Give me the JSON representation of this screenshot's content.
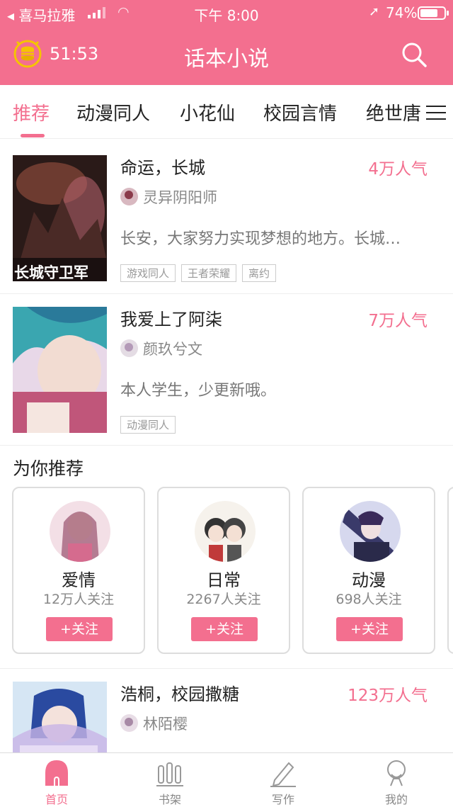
{
  "status_bar": {
    "carrier": "◂ 喜马拉雅",
    "time": "下午 8:00",
    "battery": "74%"
  },
  "header": {
    "timer": "51:53",
    "title": "话本小说"
  },
  "tabs": [
    {
      "label": "推荐",
      "active": true
    },
    {
      "label": "动漫同人",
      "active": false
    },
    {
      "label": "小花仙",
      "active": false
    },
    {
      "label": "校园言情",
      "active": false
    },
    {
      "label": "绝世唐",
      "active": false
    }
  ],
  "books": [
    {
      "title": "命运，长城",
      "popularity": "4万人气",
      "author": "灵异阴阳师",
      "description": "长安，大家努力实现梦想的地方。长城…",
      "tags": [
        "游戏同人",
        "王者荣耀",
        "离约"
      ],
      "cover_text": "长城守卫军"
    },
    {
      "title": "我爱上了阿柒",
      "popularity": "7万人气",
      "author": "颜玖兮文",
      "description": "本人学生，少更新哦。",
      "tags": [
        "动漫同人"
      ]
    },
    {
      "title": "浩桐，校园撒糖",
      "popularity": "123万人气",
      "author": "林陌樱"
    }
  ],
  "recommend": {
    "heading": "为你推荐",
    "cards": [
      {
        "name": "爱情",
        "follows": "12万人关注",
        "button": "+关注"
      },
      {
        "name": "日常",
        "follows": "2267人关注",
        "button": "+关注"
      },
      {
        "name": "动漫",
        "follows": "698人关注",
        "button": "+关注"
      }
    ]
  },
  "bottom_nav": [
    {
      "label": "首页",
      "icon": "home-icon",
      "active": true
    },
    {
      "label": "书架",
      "icon": "bookshelf-icon",
      "active": false
    },
    {
      "label": "写作",
      "icon": "pen-icon",
      "active": false
    },
    {
      "label": "我的",
      "icon": "profile-icon",
      "active": false
    }
  ],
  "colors": {
    "accent": "#f36f8f",
    "text": "#222222",
    "muted": "#888888"
  }
}
